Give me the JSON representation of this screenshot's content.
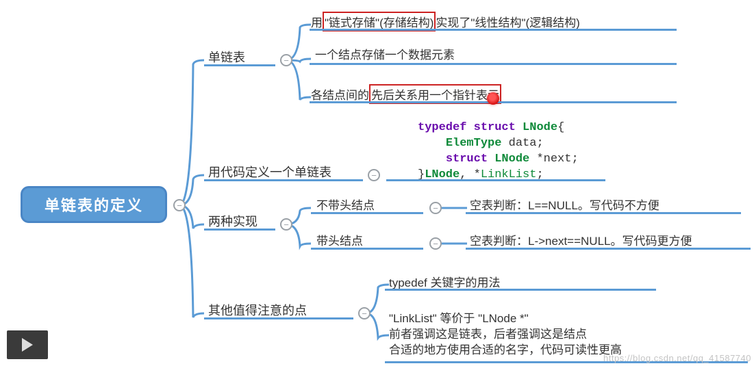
{
  "root": {
    "title": "单链表的定义"
  },
  "level1": {
    "n1": {
      "label": "单链表"
    },
    "n2": {
      "label": "用代码定义一个单链表"
    },
    "n3": {
      "label": "两种实现"
    },
    "n4": {
      "label": "其他值得注意的点"
    }
  },
  "leaves": {
    "l1a_pre": "用",
    "l1a_box": "\"链式存储\"(存储结构)",
    "l1a_post": "实现了\"线性结构\"(逻辑结构)",
    "l1b": "一个结点存储一个数据元素",
    "l1c_pre": "各结点间的",
    "l1c_box": "先后关系用一个指针表示",
    "code_line1_kw1": "typedef",
    "code_line1_kw2": "struct",
    "code_line1_typ": "LNode",
    "code_line1_rest": "{",
    "code_line2_typ": "ElemType",
    "code_line2_rest": " data;",
    "code_line3_kw": "struct",
    "code_line3_typ": "LNode",
    "code_line3_rest": " *next;",
    "code_line4_a": "}",
    "code_line4_t1": "LNode",
    "code_line4_mid": ", *",
    "code_line4_t2": "LinkList",
    "code_line4_end": ";",
    "l3a_lbl": "不带头结点",
    "l3a_txt": "空表判断：L==NULL。写代码不方便",
    "l3b_lbl": "带头结点",
    "l3b_txt": "空表判断：L->next==NULL。写代码更方便",
    "l4a": "typedef 关键字的用法",
    "l4b_1": "\"LinkList\" 等价于 \"LNode *\"",
    "l4b_2": "前者强调这是链表，后者强调这是结点",
    "l4b_3": "合适的地方使用合适的名字，代码可读性更高"
  },
  "watermark": "https://blog.csdn.net/qq_41587740",
  "collapse_glyph": "−"
}
